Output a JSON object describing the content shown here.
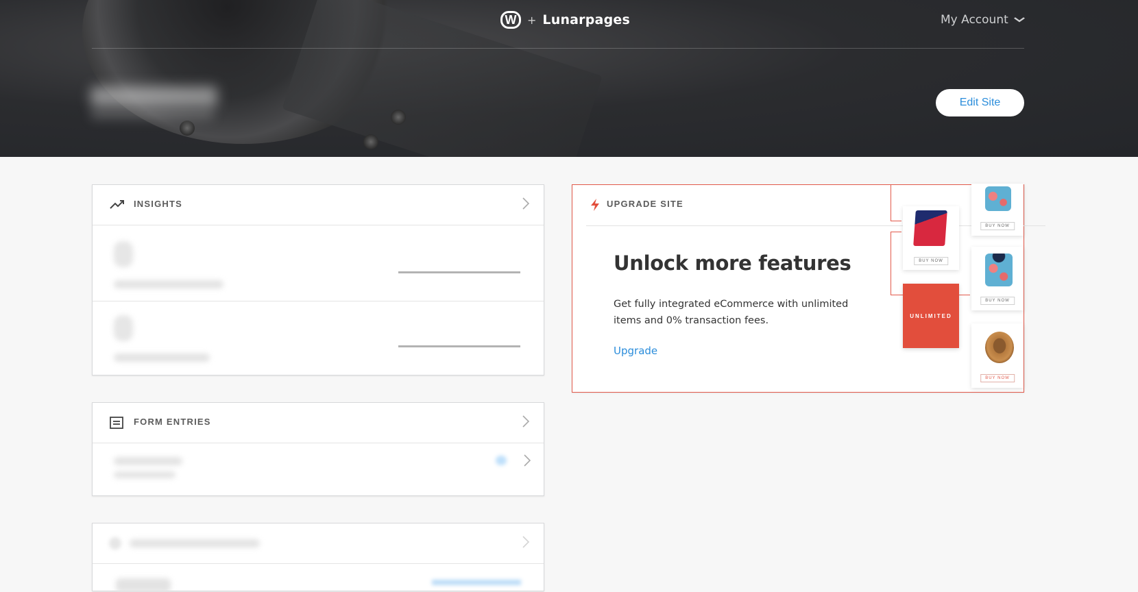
{
  "header": {
    "brand_plus": "+",
    "brand_name": "Lunarpages",
    "account_label": "My Account",
    "edit_button": "Edit Site"
  },
  "insights": {
    "title": "INSIGHTS"
  },
  "form_entries": {
    "title": "FORM ENTRIES"
  },
  "upgrade": {
    "title": "UPGRADE SITE",
    "headline": "Unlock more features",
    "description": "Get fully integrated eCommerce with unlimited items and 0% transaction fees.",
    "link": "Upgrade",
    "promo_buy_label": "BUY NOW",
    "promo_badge": "UNLIMITED"
  },
  "colors": {
    "accent_blue": "#2b8ddb",
    "accent_red": "#e2594a",
    "hero_bg": "#2b2c2f",
    "page_bg": "#f7f7f7"
  },
  "icons": {
    "brand_logo": "weebly-w-icon",
    "account": "chevron-down-icon",
    "insights": "trending-up-icon",
    "form_entries": "form-icon",
    "upgrade": "lightning-bolt-icon",
    "arrow": "chevron-right-icon"
  }
}
